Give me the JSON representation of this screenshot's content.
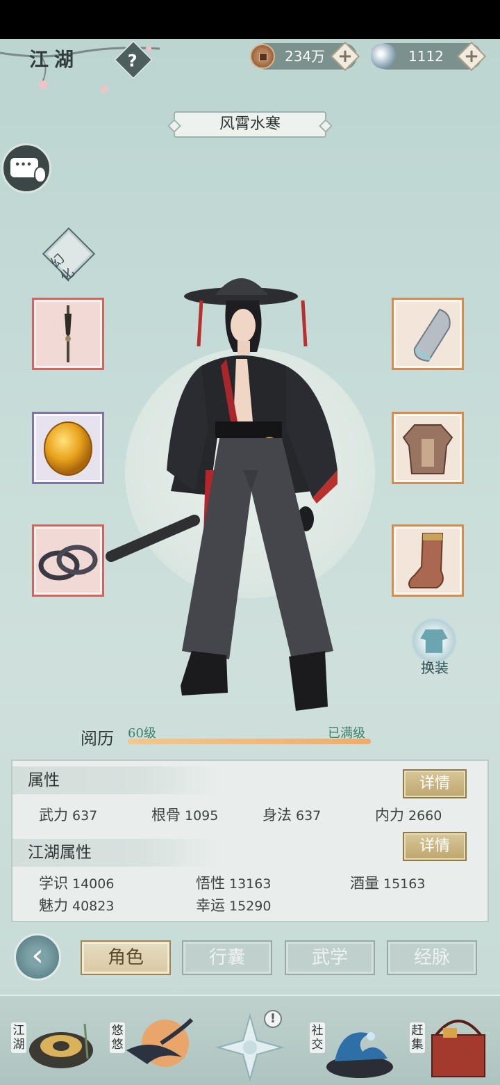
{
  "header": {
    "title": "江湖",
    "help_icon": "question-icon",
    "currencies": [
      {
        "name": "coin",
        "icon": "copper-coin-icon",
        "value": "234万"
      },
      {
        "name": "silver",
        "icon": "silver-ingot-icon",
        "value": "1112"
      }
    ]
  },
  "costume_name": "风霄水寒",
  "huanhua": {
    "char1": "幻",
    "char2": "化"
  },
  "equipment": {
    "left": [
      {
        "slot": "weapon",
        "icon": "dart-weapon-icon",
        "rarity_color": "#d6625c"
      },
      {
        "slot": "amulet",
        "icon": "amber-gem-icon",
        "rarity_color": "#8076a3"
      },
      {
        "slot": "ring",
        "icon": "bracelet-icon",
        "rarity_color": "#d6625c"
      }
    ],
    "right": [
      {
        "slot": "bracer",
        "icon": "bracer-icon",
        "rarity_color": "#d88b4c"
      },
      {
        "slot": "armor",
        "icon": "armor-icon",
        "rarity_color": "#d88b4c"
      },
      {
        "slot": "boots",
        "icon": "boots-icon",
        "rarity_color": "#d88b4c"
      }
    ]
  },
  "wardrobe_label": "换装",
  "experience": {
    "label": "阅历",
    "level": "60级",
    "status": "已满级",
    "progress": 1.0
  },
  "attributes": {
    "title": "属性",
    "detail_label": "详情",
    "items": [
      {
        "name": "武力",
        "value": "637"
      },
      {
        "name": "根骨",
        "value": "1095"
      },
      {
        "name": "身法",
        "value": "637"
      },
      {
        "name": "内力",
        "value": "2660"
      }
    ]
  },
  "jianghu_attributes": {
    "title": "江湖属性",
    "detail_label": "详情",
    "items": [
      {
        "name": "学识",
        "value": "14006"
      },
      {
        "name": "悟性",
        "value": "13163"
      },
      {
        "name": "酒量",
        "value": "15163"
      },
      {
        "name": "魅力",
        "value": "40823"
      },
      {
        "name": "幸运",
        "value": "15290"
      }
    ]
  },
  "tabs": [
    {
      "label": "角色",
      "active": true
    },
    {
      "label": "行囊",
      "active": false
    },
    {
      "label": "武学",
      "active": false
    },
    {
      "label": "经脉",
      "active": false
    }
  ],
  "bottom_nav": [
    {
      "label": "江湖"
    },
    {
      "label": "悠悠"
    },
    {
      "label": "",
      "badge": "!"
    },
    {
      "label": "社交"
    },
    {
      "label": "赶集"
    }
  ],
  "colors": {
    "accent_gold": "#bea66d",
    "exp_bar": "#f0ab6b",
    "level_text": "#3a7f67"
  }
}
